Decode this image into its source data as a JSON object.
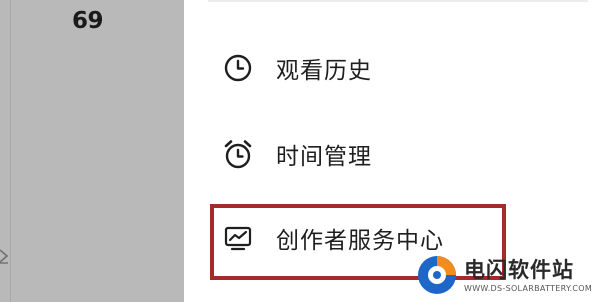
{
  "left_panel": {
    "count": "69"
  },
  "menu": {
    "items": [
      {
        "label": "观看历史",
        "icon": "clock-icon"
      },
      {
        "label": "时间管理",
        "icon": "alarm-clock-icon"
      },
      {
        "label": "创作者服务中心",
        "icon": "trend-chart-icon"
      }
    ]
  },
  "watermark": {
    "brand": "电闪软件站",
    "url": "WWW.DS-SOLARBATTERY.COM"
  },
  "colors": {
    "panel_bg": "#b9b9b9",
    "highlight": "#a52a2a",
    "text": "#1f1f1f",
    "logo_blue": "#1e66c8",
    "logo_orange": "#f28c1c"
  }
}
